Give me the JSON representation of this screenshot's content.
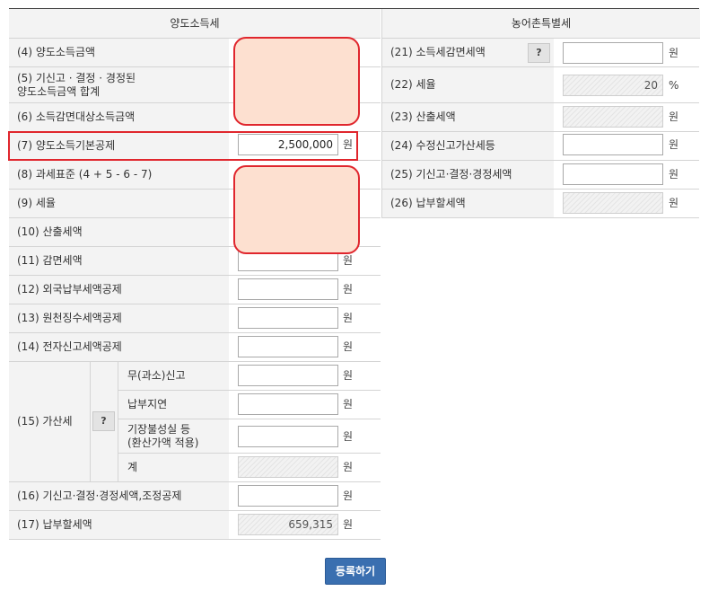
{
  "headers": {
    "left": "양도소득세",
    "right": "농어촌특별세"
  },
  "unit_won": "원",
  "unit_percent": "%",
  "left_rows": [
    {
      "label": "(4) 양도소득금액",
      "value": ""
    },
    {
      "label": "(5) 기신고 · 결정 · 경정된\n양도소득금액 합계",
      "value": ""
    },
    {
      "label": "(6) 소득감면대상소득금액",
      "value": ""
    },
    {
      "label": "(7) 양도소득기본공제",
      "value": "2,500,000"
    },
    {
      "label": "(8) 과세표준 (4 + 5 - 6 - 7)",
      "value": ""
    },
    {
      "label": "(9) 세율",
      "value": ""
    },
    {
      "label": "(10) 산출세액",
      "value": ""
    },
    {
      "label": "(11) 감면세액",
      "value": ""
    },
    {
      "label": "(12) 외국납부세액공제",
      "value": ""
    },
    {
      "label": "(13) 원천징수세액공제",
      "value": ""
    },
    {
      "label": "(14) 전자신고세액공제",
      "value": ""
    },
    {
      "label": "(16) 기신고·결정·경정세액,조정공제",
      "value": ""
    },
    {
      "label": "(17) 납부할세액",
      "value": "659,315"
    }
  ],
  "penalty": {
    "label": "(15) 가산세",
    "help": "?",
    "items": [
      {
        "label": "무(과소)신고",
        "value": ""
      },
      {
        "label": "납부지연",
        "value": ""
      },
      {
        "label": "기장불성실 등\n(환산가액 적용)",
        "value": ""
      },
      {
        "label": "계",
        "value": ""
      }
    ]
  },
  "right_rows": [
    {
      "label": "(21) 소득세감면세액",
      "value": "",
      "help": "?"
    },
    {
      "label": "(22) 세율",
      "value": "20"
    },
    {
      "label": "(23) 산출세액",
      "value": ""
    },
    {
      "label": "(24) 수정신고가산세등",
      "value": ""
    },
    {
      "label": "(25) 기신고·결정·경정세액",
      "value": ""
    },
    {
      "label": "(26) 납부할세액",
      "value": ""
    }
  ],
  "submit_label": "등록하기",
  "colors": {
    "header_bg": "#f3f3f3",
    "highlight_border": "#e0262d",
    "mask_fill": "#fde0d0",
    "button_bg": "#3a6fb0"
  }
}
